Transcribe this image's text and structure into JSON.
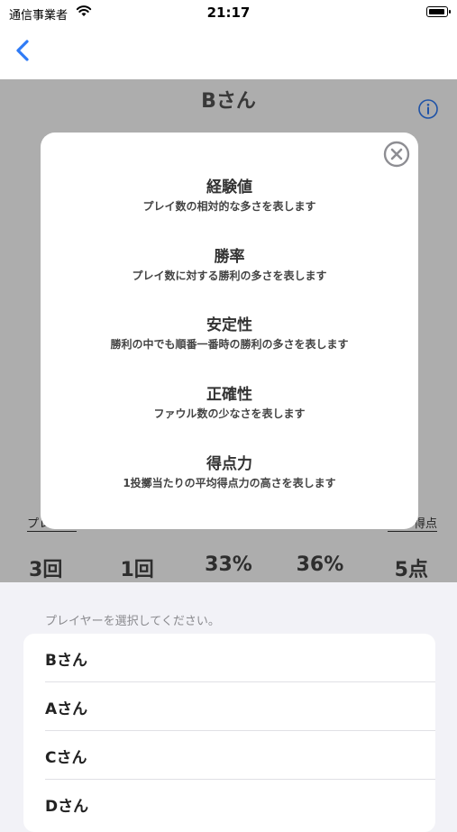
{
  "status_bar": {
    "carrier": "通信事業者",
    "time": "21:17"
  },
  "player": {
    "name": "Bさん",
    "stat_label_left": "プレ",
    "stat_label_right": "得点",
    "stats": [
      "3回",
      "1回",
      "33%",
      "36%",
      "5点"
    ]
  },
  "modal": {
    "metrics": [
      {
        "title": "経験値",
        "description": "プレイ数の相対的な多さを表します"
      },
      {
        "title": "勝率",
        "description": "プレイ数に対する勝利の多さを表します"
      },
      {
        "title": "安定性",
        "description": "勝利の中でも順番一番時の勝利の多さを表します"
      },
      {
        "title": "正確性",
        "description": "ファウル数の少なさを表します"
      },
      {
        "title": "得点力",
        "description": "1投擲当たりの平均得点力の高さを表します"
      }
    ]
  },
  "player_select": {
    "prompt": "プレイヤーを選択してください。",
    "players": [
      "Bさん",
      "Aさん",
      "Cさん",
      "Dさん"
    ]
  },
  "colors": {
    "accent": "#2f7bf6",
    "overlay": "rgba(0,0,0,0.32)"
  }
}
